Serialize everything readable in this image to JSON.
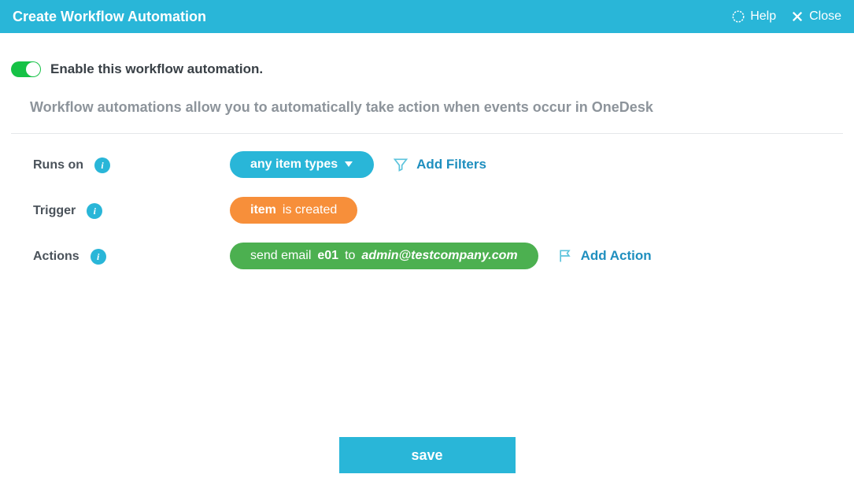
{
  "header": {
    "title": "Create Workflow Automation",
    "help": "Help",
    "close": "Close"
  },
  "enable": {
    "label": "Enable this workflow automation."
  },
  "description": "Workflow automations allow you to automatically take action when events occur in OneDesk",
  "runs_on": {
    "label": "Runs on",
    "pill": "any item types",
    "add_filters": "Add Filters"
  },
  "trigger": {
    "label": "Trigger",
    "pill_bold": "item",
    "pill_rest": "is created"
  },
  "actions": {
    "label": "Actions",
    "action_prefix": "send email",
    "action_code": "e01",
    "action_to": "to",
    "action_target": "admin@testcompany.com",
    "add_action": "Add Action"
  },
  "save": "save"
}
